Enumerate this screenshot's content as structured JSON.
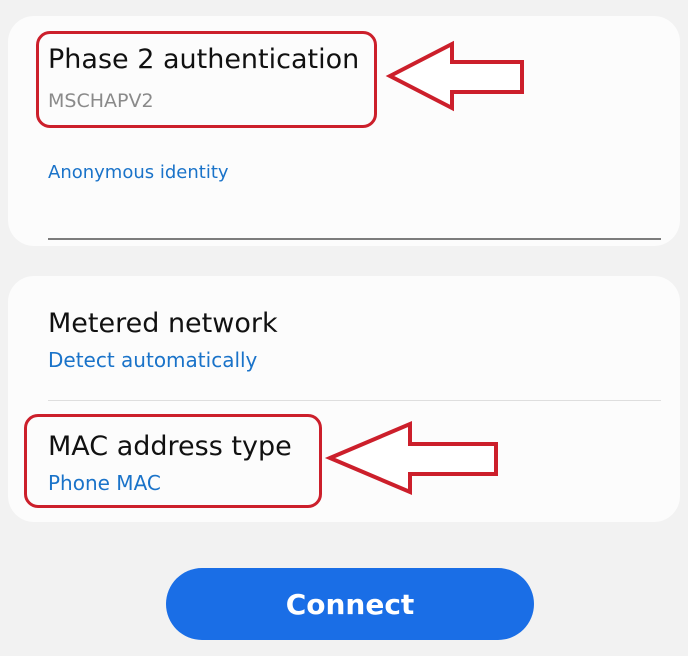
{
  "eap_section": {
    "phase2": {
      "label": "Phase 2 authentication",
      "value": "MSCHAPV2"
    },
    "anonymous_identity": {
      "label": "Anonymous identity",
      "value": ""
    }
  },
  "advanced_section": {
    "metered": {
      "label": "Metered network",
      "value": "Detect automatically"
    },
    "mac_type": {
      "label": "MAC address type",
      "value": "Phone MAC"
    }
  },
  "connect_button": {
    "label": "Connect"
  },
  "colors": {
    "accent_blue": "#1a73c9",
    "button_blue": "#1a6ee6",
    "annotation_red": "#cc1f2b"
  },
  "annotations": [
    {
      "name": "arrow-pointing-left-icon",
      "target": "phase2"
    },
    {
      "name": "arrow-pointing-left-icon",
      "target": "mac_type"
    }
  ]
}
